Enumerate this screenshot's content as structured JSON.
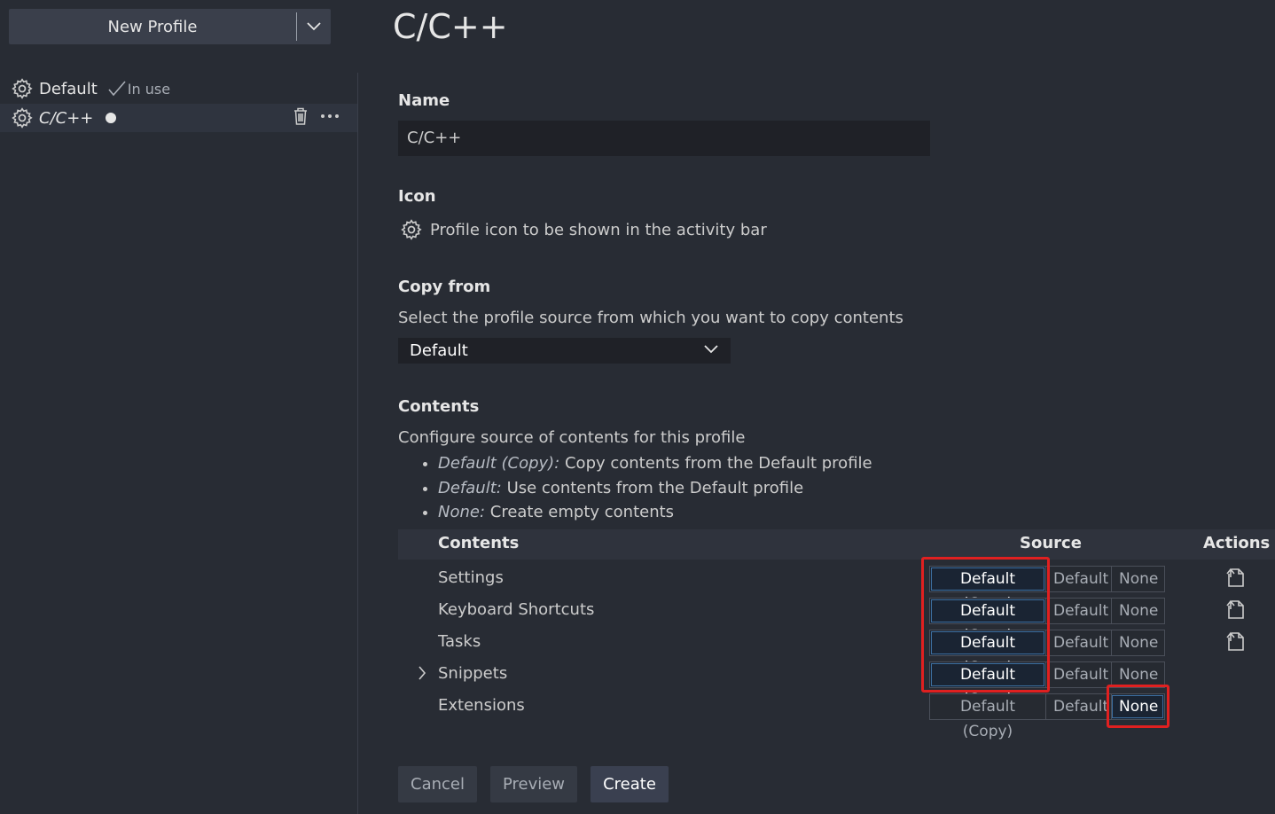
{
  "sidebar": {
    "new_profile_label": "New Profile",
    "profiles": [
      {
        "name": "Default",
        "status": "In use"
      },
      {
        "name": "C/C++"
      }
    ]
  },
  "main": {
    "title": "C/C++",
    "name_section": {
      "heading": "Name",
      "value": "C/C++"
    },
    "icon_section": {
      "heading": "Icon",
      "description": "Profile icon to be shown in the activity bar",
      "icon": "gear-icon"
    },
    "copy_from": {
      "heading": "Copy from",
      "description": "Select the profile source from which you want to copy contents",
      "selected": "Default"
    },
    "contents": {
      "heading": "Contents",
      "description": "Configure source of contents for this profile",
      "legend": [
        {
          "term": "Default (Copy):",
          "text": " Copy contents from the Default profile"
        },
        {
          "term": "Default:",
          "text": " Use contents from the Default profile"
        },
        {
          "term": "None:",
          "text": " Create empty contents"
        }
      ],
      "columns": [
        "Contents",
        "Source",
        "Actions"
      ],
      "options": [
        "Default (Copy)",
        "Default",
        "None"
      ],
      "rows": [
        {
          "label": "Settings",
          "selected": "Default (Copy)"
        },
        {
          "label": "Keyboard Shortcuts",
          "selected": "Default (Copy)"
        },
        {
          "label": "Tasks",
          "selected": "Default (Copy)"
        },
        {
          "label": "Snippets",
          "selected": "Default (Copy)"
        },
        {
          "label": "Extensions",
          "selected": "None"
        }
      ]
    },
    "buttons": {
      "cancel": "Cancel",
      "preview": "Preview",
      "create": "Create"
    }
  },
  "colors": {
    "background": "#282c34",
    "highlight": "#e02020",
    "selected_border": "#3d6fa0"
  }
}
